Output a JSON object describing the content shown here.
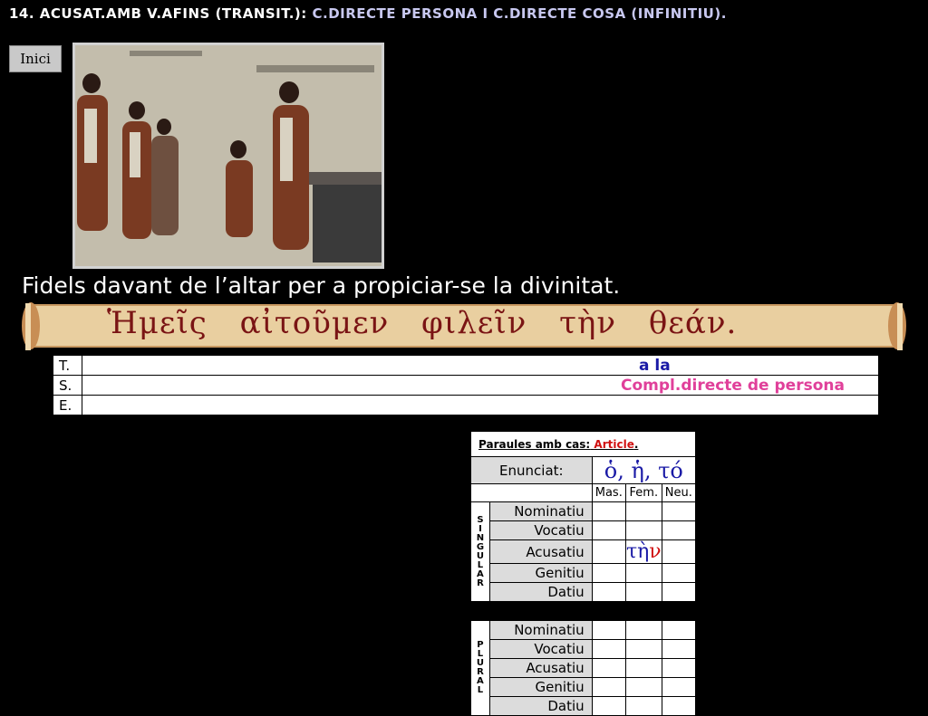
{
  "header": {
    "title_part1": "14. ACUSAT.AMB V.AFINS (TRANSIT.):",
    "title_part2": "C.DIRECTE PERSONA I C.DIRECTE COSA (INFINITIU)."
  },
  "nav": {
    "home_label": "Inici"
  },
  "caption": "Fidels davant de l’altar per a propiciar-se la divinitat.",
  "greek_sentence": "Ἡμεῖς αἰτοῦμεν φιλεῖν τὴν θεάν.",
  "analysis": {
    "rows": [
      {
        "label": "T.",
        "value": "a la"
      },
      {
        "label": "S.",
        "value": "Compl.directe de persona"
      },
      {
        "label": "E.",
        "value": ""
      }
    ]
  },
  "article_table": {
    "heading_prefix": "Paraules amb cas:",
    "heading_highlight": "Article",
    "heading_suffix": ".",
    "enunciat_label": "Enunciat:",
    "enunciat_value": "ὁ, ἡ, τό",
    "genders": [
      "Mas.",
      "Fem.",
      "Neu."
    ],
    "singular_label": "SINGULAR",
    "plural_label": "PLURAL",
    "cases": [
      "Nominatiu",
      "Vocatiu",
      "Acusatiu",
      "Genitiu",
      "Datiu"
    ],
    "answer_stem": "τὴ",
    "answer_ending": "ν"
  },
  "colors": {
    "background": "#000000",
    "title_secondary": "#c8c8f0",
    "greek_blue": "#1a1aa6",
    "highlight_pink": "#e0409a",
    "accent_red": "#d01010",
    "scroll_text": "#7a1414"
  }
}
